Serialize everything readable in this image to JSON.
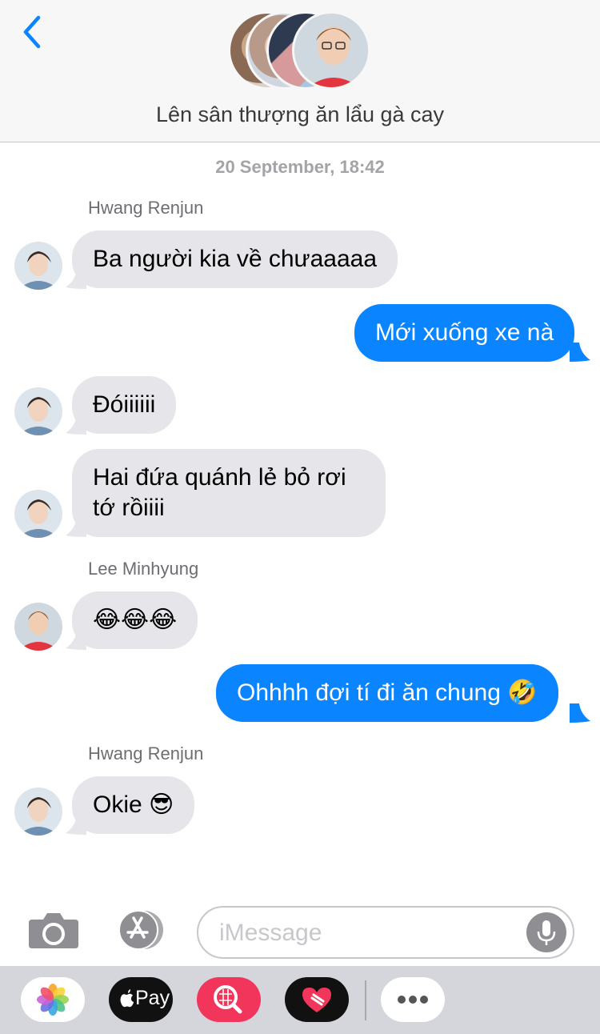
{
  "header": {
    "title": "Lên sân thượng ăn lẩu gà cay"
  },
  "chat": {
    "timestamp": "20 September, 18:42",
    "messages": [
      {
        "sender": "Hwang Renjun",
        "text": "Ba người kia về chưaaaaa"
      },
      {
        "text": "Mới xuống xe nà"
      },
      {
        "text": "Đóiiiiii"
      },
      {
        "text_line1": "Hai đứa quánh lẻ bỏ rơi",
        "text_line2": "tớ rồiiii"
      },
      {
        "sender": "Lee Minhyung",
        "text": "😂😂😂"
      },
      {
        "text": "Ohhhh đợi tí đi ăn chung 🤣"
      },
      {
        "sender": "Hwang Renjun",
        "text": "Okie 😎"
      }
    ]
  },
  "composer": {
    "placeholder": "iMessage"
  },
  "drawer": {
    "pay_label": "Pay"
  },
  "colors": {
    "outgoing_bubble": "#0a84ff",
    "incoming_bubble": "#e5e5ea",
    "accent": "#0a84ff"
  },
  "icons": [
    "chevron-left-icon",
    "camera-icon",
    "app-store-icon",
    "microphone-icon",
    "photos-icon",
    "apple-pay-icon",
    "search-gif-icon",
    "digital-touch-icon",
    "more-icon"
  ]
}
